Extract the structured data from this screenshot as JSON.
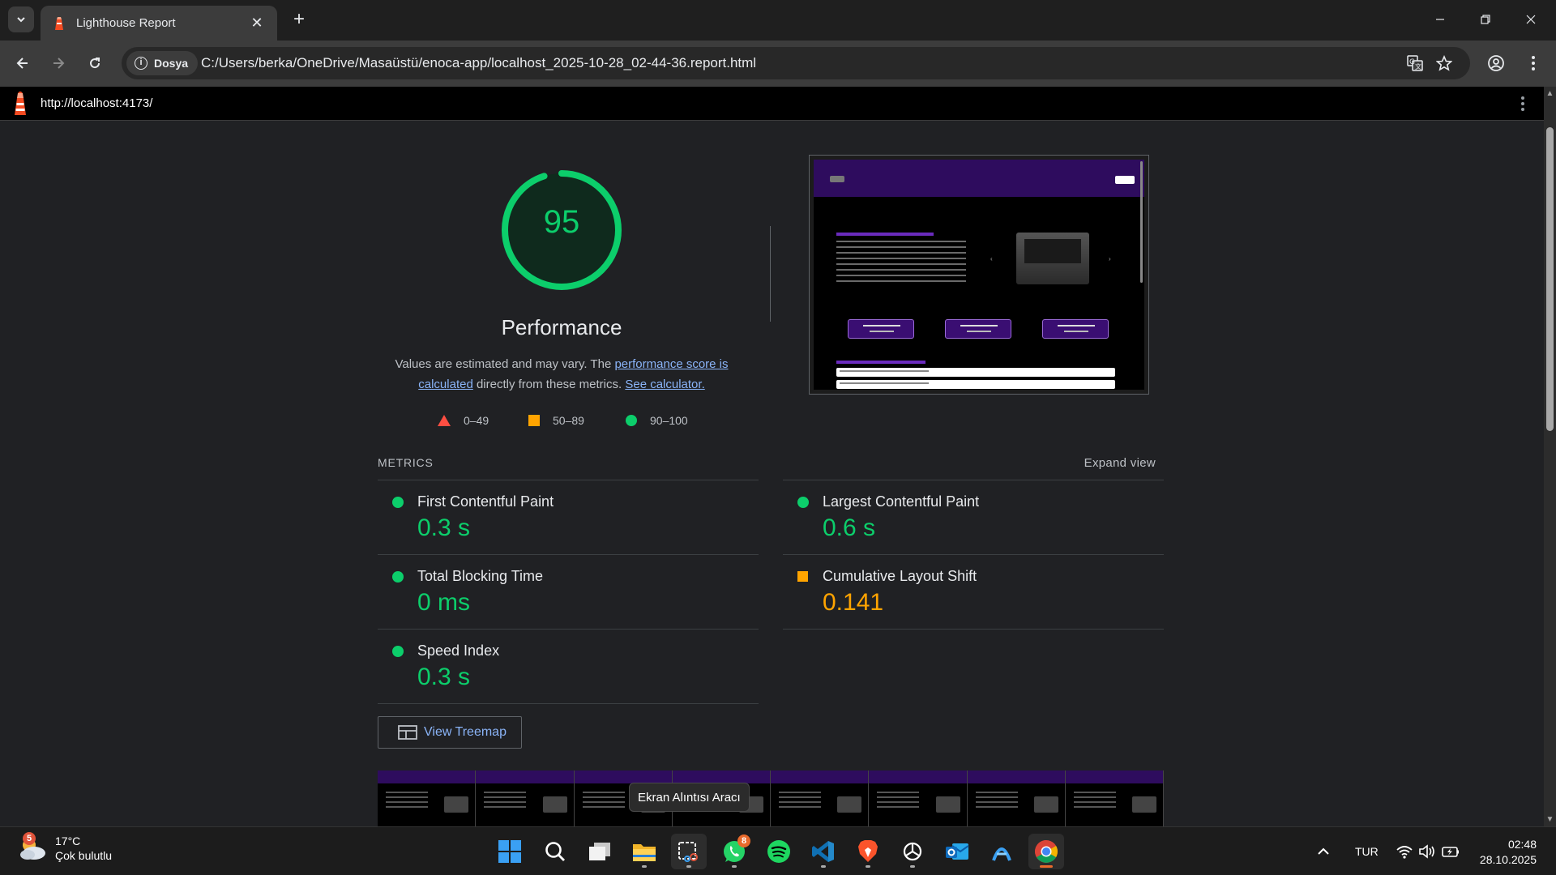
{
  "browser": {
    "tab_title": "Lighthouse Report",
    "site_chip": "Dosya",
    "url": "C:/Users/berka/OneDrive/Masaüstü/enoca-app/localhost_2025-10-28_02-44-36.report.html"
  },
  "report": {
    "tested_url": "http://localhost:4173/",
    "score": "95",
    "category": "Performance",
    "desc_prefix": "Values are estimated and may vary. The ",
    "desc_link1": "performance score is calculated",
    "desc_middle": " directly from these metrics. ",
    "desc_link2": "See calculator.",
    "legend": [
      {
        "range": "0–49",
        "color": "#ff4e42"
      },
      {
        "range": "50–89",
        "color": "#ffa400"
      },
      {
        "range": "90–100",
        "color": "#0cce6b"
      }
    ],
    "metrics_label": "METRICS",
    "expand_label": "Expand view",
    "metrics": [
      {
        "name": "First Contentful Paint",
        "value": "0.3 s",
        "rating": "good"
      },
      {
        "name": "Largest Contentful Paint",
        "value": "0.6 s",
        "rating": "good"
      },
      {
        "name": "Total Blocking Time",
        "value": "0 ms",
        "rating": "good"
      },
      {
        "name": "Cumulative Layout Shift",
        "value": "0.141",
        "rating": "average"
      },
      {
        "name": "Speed Index",
        "value": "0.3 s",
        "rating": "good"
      }
    ],
    "treemap_label": "View Treemap",
    "colors": {
      "good": "#0cce6b",
      "average": "#ffa400",
      "poor": "#ff4e42"
    }
  },
  "tooltip": "Ekran Alıntısı Aracı",
  "taskbar": {
    "weather_temp": "17°C",
    "weather_desc": "Çok bulutlu",
    "weather_badge": "5",
    "whatsapp_badge": "8",
    "language": "TUR",
    "time": "02:48",
    "date": "28.10.2025"
  }
}
